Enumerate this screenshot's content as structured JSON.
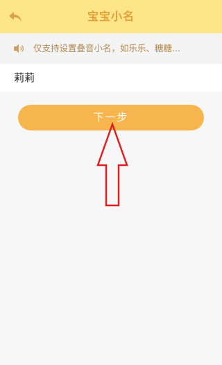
{
  "header": {
    "title": "宝宝小名",
    "back_icon": "back-arrow-icon"
  },
  "notice": {
    "icon": "speaker-icon",
    "text": "仅支持设置叠音小名，如乐乐、糖糖..."
  },
  "name_field": {
    "value": "莉莉"
  },
  "next_button": {
    "label": "下一步"
  },
  "colors": {
    "header_bg": "#ffe58a",
    "title": "#e0a03a",
    "button": "#f7b64d",
    "annotation_arrow": "#e02020"
  }
}
